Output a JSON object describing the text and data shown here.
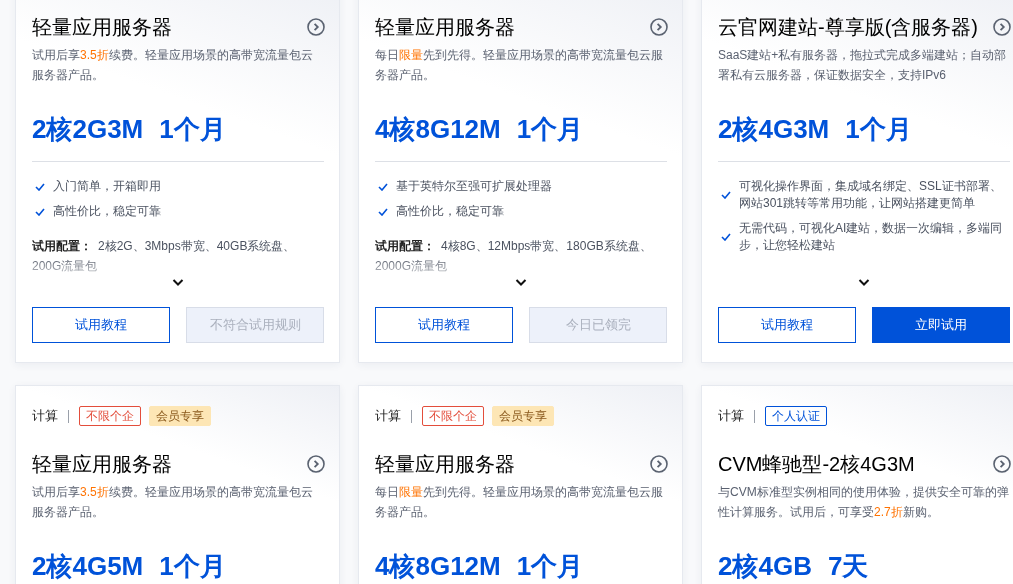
{
  "cards": [
    {
      "title": "轻量应用服务器",
      "description": [
        {
          "text": "试用后享",
          "highlight": false
        },
        {
          "text": "3.5折",
          "highlight": true
        },
        {
          "text": "续费。轻量应用场景的高带宽流量包云服务器产品。",
          "highlight": false
        }
      ],
      "spec": "2核2G3M",
      "duration": "1个月",
      "features": [
        "入门简单，开箱即用",
        "高性价比，稳定可靠"
      ],
      "config_label": "试用配置：",
      "config": "2核2G、3Mbps带宽、40GB系统盘、200G流量包",
      "buttons": [
        {
          "label": "试用教程",
          "kind": "outline",
          "disabled": false
        },
        {
          "label": "不符合试用规则",
          "kind": "solid",
          "disabled": true
        }
      ]
    },
    {
      "title": "轻量应用服务器",
      "description": [
        {
          "text": "每日",
          "highlight": false
        },
        {
          "text": "限量",
          "highlight": true
        },
        {
          "text": "先到先得。轻量应用场景的高带宽流量包云服务器产品。",
          "highlight": false
        }
      ],
      "spec": "4核8G12M",
      "duration": "1个月",
      "features": [
        "基于英特尔至强可扩展处理器",
        "高性价比，稳定可靠"
      ],
      "config_label": "试用配置：",
      "config": "4核8G、12Mbps带宽、180GB系统盘、2000G流量包",
      "buttons": [
        {
          "label": "试用教程",
          "kind": "outline",
          "disabled": false
        },
        {
          "label": "今日已领完",
          "kind": "solid",
          "disabled": true
        }
      ]
    },
    {
      "title": "云官网建站-尊享版(含服务器)",
      "description": [
        {
          "text": "SaaS建站+私有服务器，拖拉式完成多端建站；自动部署私有云服务器，保证数据安全，支持IPv6",
          "highlight": false
        }
      ],
      "spec": "2核4G3M",
      "duration": "1个月",
      "features": [
        "可视化操作界面，集成域名绑定、SSL证书部署、网站301跳转等常用功能，让网站搭建更简单",
        "无需代码，可视化AI建站，数据一次编辑，多端同步，让您轻松建站"
      ],
      "buttons": [
        {
          "label": "试用教程",
          "kind": "outline",
          "disabled": false
        },
        {
          "label": "立即试用",
          "kind": "solid",
          "disabled": false
        }
      ]
    },
    {
      "category": "计算",
      "tags": [
        {
          "label": "不限个企",
          "kind": "outline",
          "color": "#e34d3b"
        },
        {
          "label": "会员专享",
          "kind": "filled",
          "color": "#fde6b5"
        }
      ],
      "title": "轻量应用服务器",
      "description": [
        {
          "text": "试用后享",
          "highlight": false
        },
        {
          "text": "3.5折",
          "highlight": true
        },
        {
          "text": "续费。轻量应用场景的高带宽流量包云服务器产品。",
          "highlight": false
        }
      ],
      "spec": "2核4G5M",
      "duration": "1个月"
    },
    {
      "category": "计算",
      "tags": [
        {
          "label": "不限个企",
          "kind": "outline",
          "color": "#e34d3b"
        },
        {
          "label": "会员专享",
          "kind": "filled",
          "color": "#fde6b5"
        }
      ],
      "title": "轻量应用服务器",
      "description": [
        {
          "text": "每日",
          "highlight": false
        },
        {
          "text": "限量",
          "highlight": true
        },
        {
          "text": "先到先得。轻量应用场景的高带宽流量包云服务器产品。",
          "highlight": false
        }
      ],
      "spec": "4核8G12M",
      "duration": "1个月"
    },
    {
      "category": "计算",
      "tags": [
        {
          "label": "个人认证",
          "kind": "outline",
          "color": "#0052d9"
        }
      ],
      "title": "CVM蜂驰型-2核4G3M",
      "description": [
        {
          "text": "与CVM标准型实例相同的使用体验，提供安全可靠的弹性计算服务。试用后，可享受",
          "highlight": false
        },
        {
          "text": "2.7折",
          "highlight": true
        },
        {
          "text": "新购。",
          "highlight": false
        }
      ],
      "spec": "2核4GB",
      "duration": "7天"
    }
  ]
}
